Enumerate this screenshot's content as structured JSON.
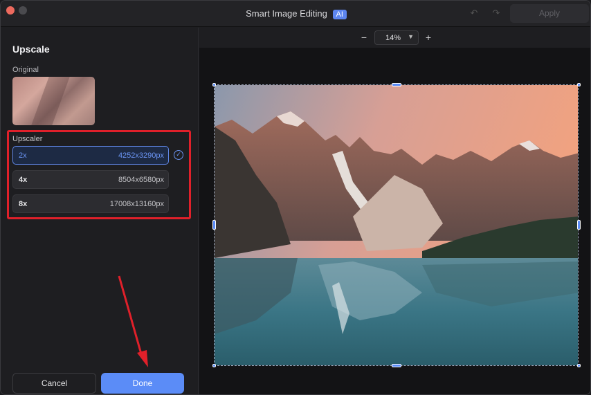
{
  "titlebar": {
    "title": "Smart Image Editing",
    "ai_badge": "AI",
    "undo_icon": "undo-icon",
    "redo_icon": "redo-icon",
    "apply_label": "Apply"
  },
  "panel": {
    "title": "Upscale",
    "original_label": "Original",
    "upscaler_label": "Upscaler",
    "options": [
      {
        "scale": "2x",
        "resolution": "4252x3290px",
        "selected": true
      },
      {
        "scale": "4x",
        "resolution": "8504x6580px",
        "selected": false
      },
      {
        "scale": "8x",
        "resolution": "17008x13160px",
        "selected": false
      }
    ],
    "cancel_label": "Cancel",
    "done_label": "Done"
  },
  "zoom": {
    "minus": "−",
    "value": "14%",
    "plus": "+"
  },
  "colors": {
    "accent": "#5b8cf7",
    "highlight_box": "#e0202a"
  }
}
